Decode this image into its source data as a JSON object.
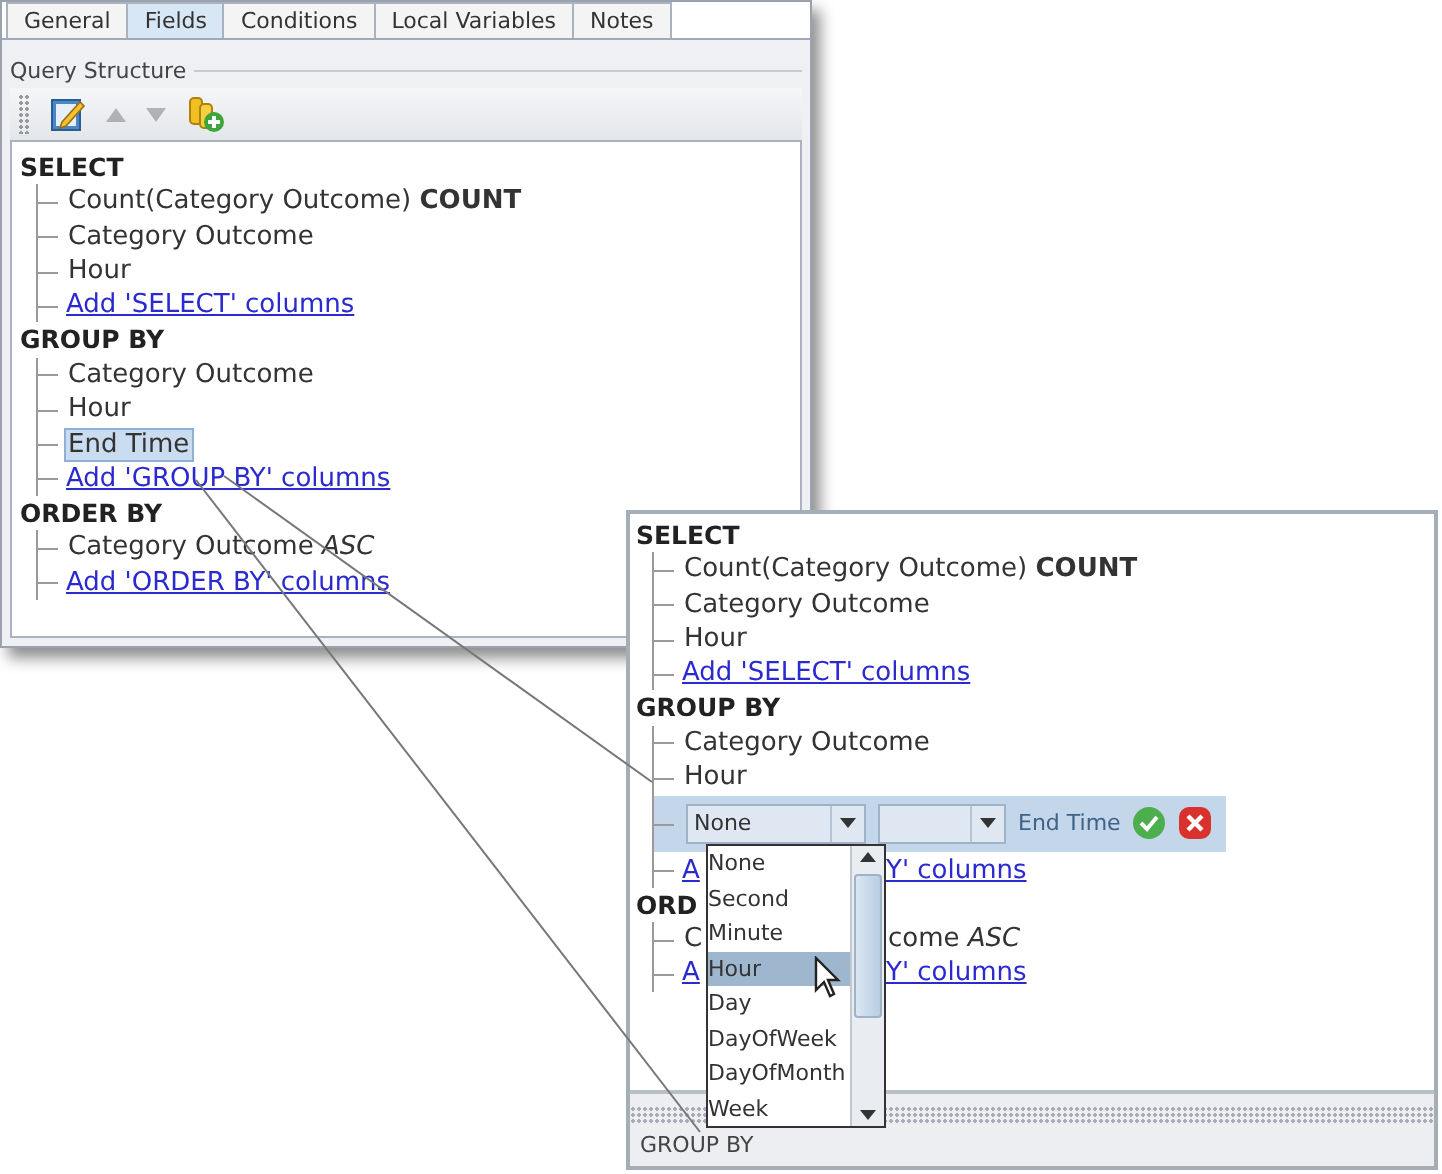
{
  "tabs": [
    {
      "label": "General",
      "selected": false
    },
    {
      "label": "Fields",
      "selected": true
    },
    {
      "label": "Conditions",
      "selected": false
    },
    {
      "label": "Local Variables",
      "selected": false
    },
    {
      "label": "Notes",
      "selected": false
    }
  ],
  "group_title": "Query Structure",
  "toolbar": [
    {
      "kind": "edit",
      "disabled": false
    },
    {
      "kind": "up",
      "disabled": true
    },
    {
      "kind": "down",
      "disabled": true
    },
    {
      "kind": "add",
      "disabled": false
    }
  ],
  "tree": [
    {
      "heading": "SELECT",
      "children": [
        {
          "kind": "item",
          "text": "Count(Category Outcome) **COUNT**",
          "selected": false
        },
        {
          "kind": "item",
          "text": "Category Outcome",
          "selected": false
        },
        {
          "kind": "item",
          "text": "Hour",
          "selected": false
        },
        {
          "kind": "link",
          "text": "Add 'SELECT' columns"
        }
      ]
    },
    {
      "heading": "GROUP BY",
      "children": [
        {
          "kind": "item",
          "text": "Category Outcome",
          "selected": false
        },
        {
          "kind": "item",
          "text": "Hour",
          "selected": false
        },
        {
          "kind": "item",
          "text": "End Time",
          "selected": true
        },
        {
          "kind": "link",
          "text": "Add 'GROUP BY' columns"
        }
      ]
    },
    {
      "heading": "ORDER BY",
      "children": [
        {
          "kind": "item",
          "text": "Category Outcome *ASC*",
          "selected": false
        },
        {
          "kind": "link",
          "text": "Add 'ORDER BY' columns"
        }
      ]
    }
  ],
  "inset": {
    "tree": [
      {
        "heading": "SELECT",
        "children": [
          {
            "kind": "item",
            "text": "Count(Category Outcome) **COUNT**",
            "selected": false
          },
          {
            "kind": "item",
            "text": "Category Outcome",
            "selected": false
          },
          {
            "kind": "item",
            "text": "Hour",
            "selected": false
          },
          {
            "kind": "link",
            "text": "Add 'SELECT' columns"
          }
        ]
      },
      {
        "heading": "GROUP BY",
        "children": [
          {
            "kind": "item",
            "text": "Category Outcome",
            "selected": false
          },
          {
            "kind": "item",
            "text": "Hour",
            "selected": false
          },
          {
            "kind": "editor",
            "combo_value": "None",
            "label": "End Time"
          },
          {
            "kind": "link",
            "parts": [
              "A",
              "Y' columns"
            ]
          }
        ]
      },
      {
        "heading": "ORD",
        "children": [
          {
            "kind": "item",
            "parts": [
              "C",
              "come *ASC*"
            ],
            "selected": false
          },
          {
            "kind": "link",
            "parts": [
              "A",
              "Y' columns"
            ]
          }
        ]
      }
    ],
    "dropdown": [
      {
        "label": "None",
        "selected": false
      },
      {
        "label": "Second",
        "selected": false
      },
      {
        "label": "Minute",
        "selected": false
      },
      {
        "label": "Hour",
        "selected": true
      },
      {
        "label": "Day",
        "selected": false
      },
      {
        "label": "DayOfWeek",
        "selected": false
      },
      {
        "label": "DayOfMonth",
        "selected": false
      },
      {
        "label": "Week",
        "selected": false
      }
    ],
    "footer_label": "GROUP BY"
  }
}
